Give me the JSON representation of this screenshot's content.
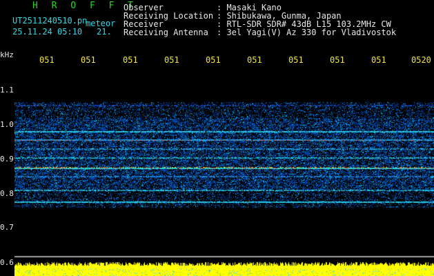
{
  "header": {
    "title": "H R O F F T",
    "file_name": "UT2511240510.pn",
    "mode": "meteor",
    "date_time": "25.11.24 05:10",
    "count": "21.",
    "fields": [
      {
        "label": "Observer",
        "value": ": Masaki Kano"
      },
      {
        "label": "Receiving Location",
        "value": ": Shibukawa, Gunma, Japan"
      },
      {
        "label": "Receiver",
        "value": ": RTL-SDR SDR# 43dB L15 103.2MHz CW"
      },
      {
        "label": "Receiving Antenna",
        "value": ": 3el Yagi(V) Az 330 for Vladivostok"
      }
    ]
  },
  "axes": {
    "y_unit": "kHz",
    "y_ticks": [
      "1.1",
      "1.0",
      "0.9",
      "0.8",
      "0.7",
      "0.6"
    ],
    "x_ticks": [
      "051",
      "051",
      "051",
      "051",
      "051",
      "051",
      "051",
      "051",
      "051",
      "0520"
    ]
  },
  "colors": {
    "background": "#000000",
    "title_green": "#2bd42b",
    "label_cyan": "#33d8e8",
    "tick_yellow": "#f2e640",
    "bottom_trace": "#ffff00"
  }
}
